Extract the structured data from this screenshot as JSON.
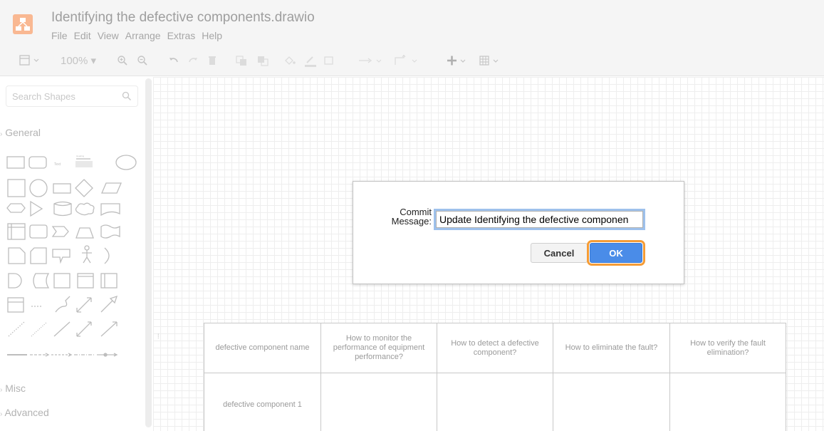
{
  "header": {
    "title": "Identifying the defective components.drawio",
    "logo_color": "#f9b892",
    "menu": [
      "File",
      "Edit",
      "View",
      "Arrange",
      "Extras",
      "Help"
    ]
  },
  "toolbar": {
    "zoom": "100%",
    "icons": [
      "format-panel-icon",
      "zoom-in-icon",
      "zoom-out-icon",
      "undo-icon",
      "redo-icon",
      "delete-icon",
      "to-front-icon",
      "to-back-icon",
      "fill-color-icon",
      "line-color-icon",
      "shadow-icon",
      "connection-icon",
      "waypoints-icon",
      "insert-icon",
      "table-icon"
    ]
  },
  "sidebar": {
    "search_placeholder": "Search Shapes",
    "sections": {
      "general": "General",
      "misc": "Misc",
      "advanced": "Advanced"
    },
    "shape_text": {
      "text": "Text",
      "heading": "Heading"
    }
  },
  "dialog": {
    "label": "Commit Message:",
    "message_value": "Update Identifying the defective componen",
    "cancel_label": "Cancel",
    "ok_label": "OK",
    "ok_color": "#4a8ce8",
    "focus_color": "#f59c36"
  },
  "table": {
    "headers": [
      "defective component name",
      "How to monitor the performance of equipment performance?",
      "How to detect a defective component?",
      "How to eliminate the fault?",
      "How to verify the fault elimination?"
    ],
    "rows": [
      [
        "defective component 1",
        "",
        "",
        "",
        ""
      ]
    ]
  }
}
